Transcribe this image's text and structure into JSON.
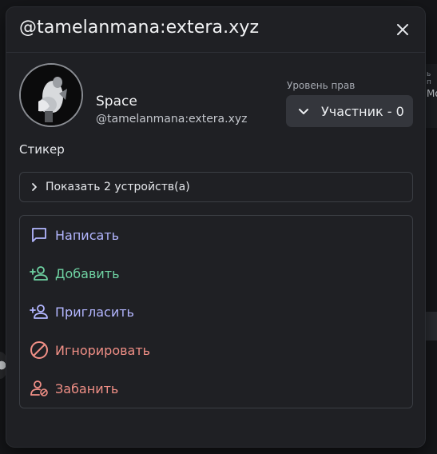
{
  "colors": {
    "modal_bg": "#1f2024",
    "accent_purple": "#b3b6ff",
    "accent_green": "#6fd3a3",
    "accent_red": "#f08f86"
  },
  "background": {
    "partial_label": "ь п",
    "partial_value": "Мо"
  },
  "header": {
    "title": "@tamelanmana:extera.xyz",
    "close_icon": "close-icon"
  },
  "profile": {
    "display_name": "Space",
    "user_id": "@tamelanmana:extera.xyz"
  },
  "power": {
    "label": "Уровень прав",
    "value": "Участник - 0"
  },
  "sticker_label": "Стикер",
  "devices": {
    "label": "Показать 2 устройств(а)"
  },
  "actions": [
    {
      "label": "Написать",
      "icon": "message-icon"
    },
    {
      "label": "Добавить",
      "icon": "add-user-icon"
    },
    {
      "label": "Пригласить",
      "icon": "invite-user-icon"
    },
    {
      "label": "Игнорировать",
      "icon": "block-icon"
    },
    {
      "label": "Забанить",
      "icon": "ban-user-icon"
    }
  ]
}
